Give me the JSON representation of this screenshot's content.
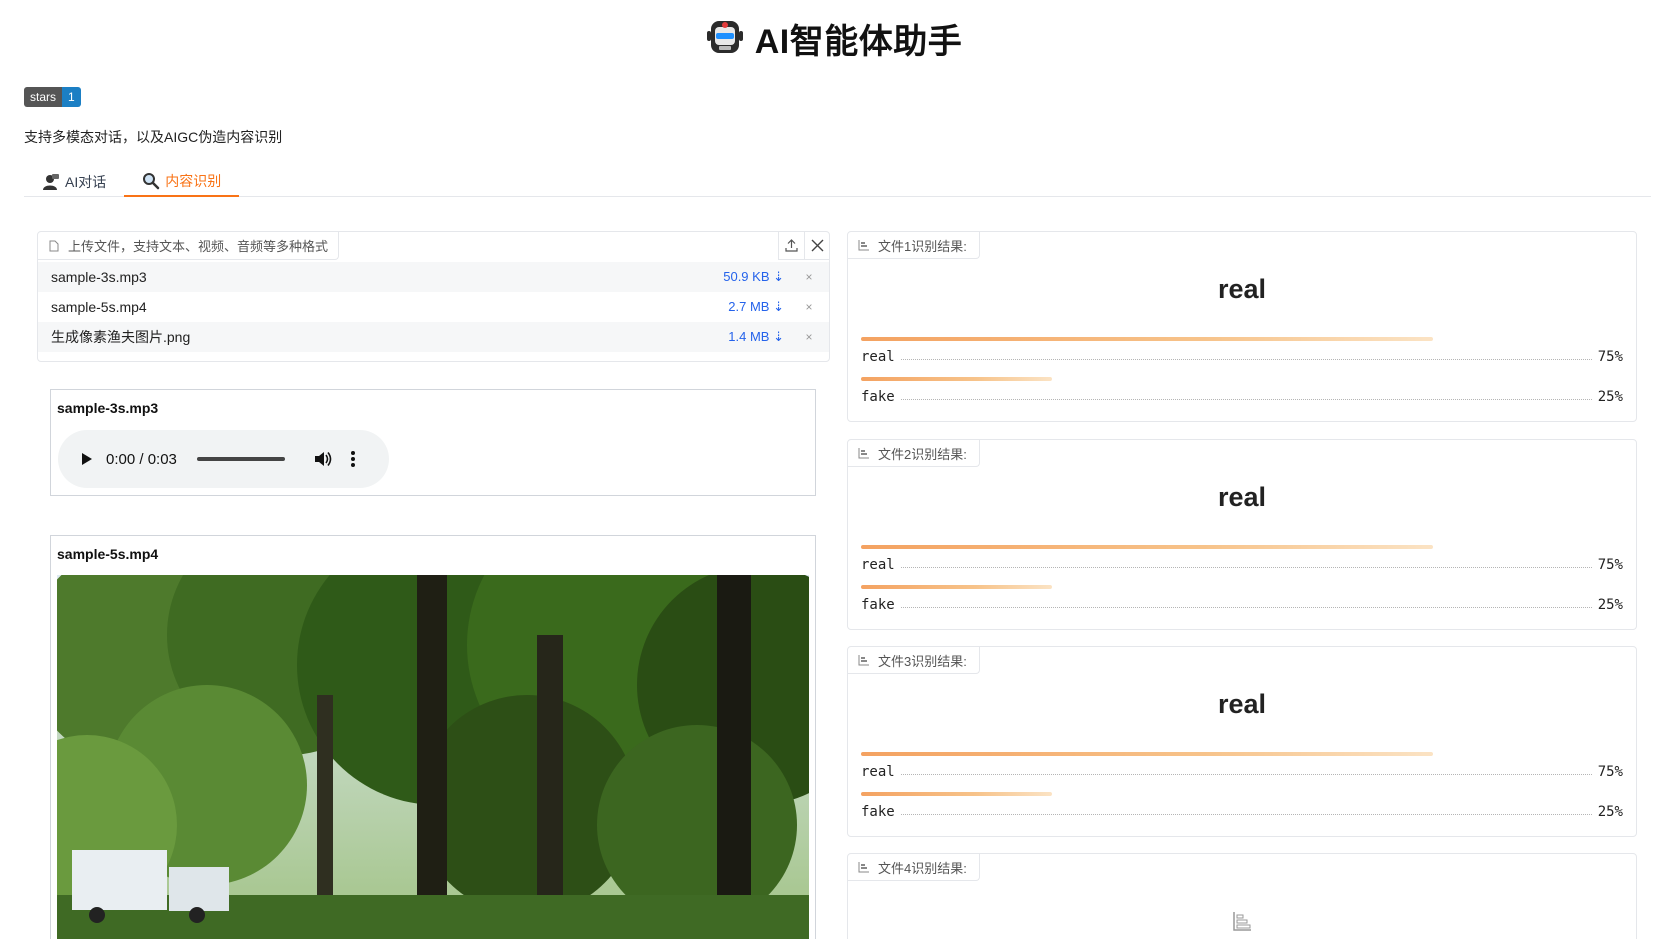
{
  "app": {
    "title": "AI智能体助手",
    "logo_icon": "robot-icon"
  },
  "badge": {
    "label": "stars",
    "value": "1"
  },
  "subtitle": "支持多模态对话，以及AIGC伪造内容识别",
  "tabs": [
    {
      "label": "AI对话",
      "icon": "chat-person-icon",
      "active": false
    },
    {
      "label": "内容识别",
      "icon": "magnifier-icon",
      "active": true
    }
  ],
  "upload": {
    "label": "上传文件，支持文本、视频、音频等多种格式",
    "files": [
      {
        "name": "sample-3s.mp3",
        "size": "50.9 KB ⇣",
        "remove": "×"
      },
      {
        "name": "sample-5s.mp4",
        "size": "2.7 MB ⇣",
        "remove": "×"
      },
      {
        "name": "生成像素渔夫图片.png",
        "size": "1.4 MB ⇣",
        "remove": "×"
      }
    ]
  },
  "audio": {
    "title": "sample-3s.mp3",
    "time": "0:00 / 0:03"
  },
  "video": {
    "title": "sample-5s.mp4"
  },
  "results": [
    {
      "label": "文件1识别结果:",
      "top": "real",
      "items": [
        {
          "name": "real",
          "pct": "75%",
          "value": 0.75
        },
        {
          "name": "fake",
          "pct": "25%",
          "value": 0.25
        }
      ]
    },
    {
      "label": "文件2识别结果:",
      "top": "real",
      "items": [
        {
          "name": "real",
          "pct": "75%",
          "value": 0.75
        },
        {
          "name": "fake",
          "pct": "25%",
          "value": 0.25
        }
      ]
    },
    {
      "label": "文件3识别结果:",
      "top": "real",
      "items": [
        {
          "name": "real",
          "pct": "75%",
          "value": 0.75
        },
        {
          "name": "fake",
          "pct": "25%",
          "value": 0.25
        }
      ]
    },
    {
      "label": "文件4识别结果:",
      "empty": true
    }
  ],
  "colors": {
    "accent": "#f97316",
    "link": "#2563eb",
    "badge_value": "#1b7fc4"
  }
}
